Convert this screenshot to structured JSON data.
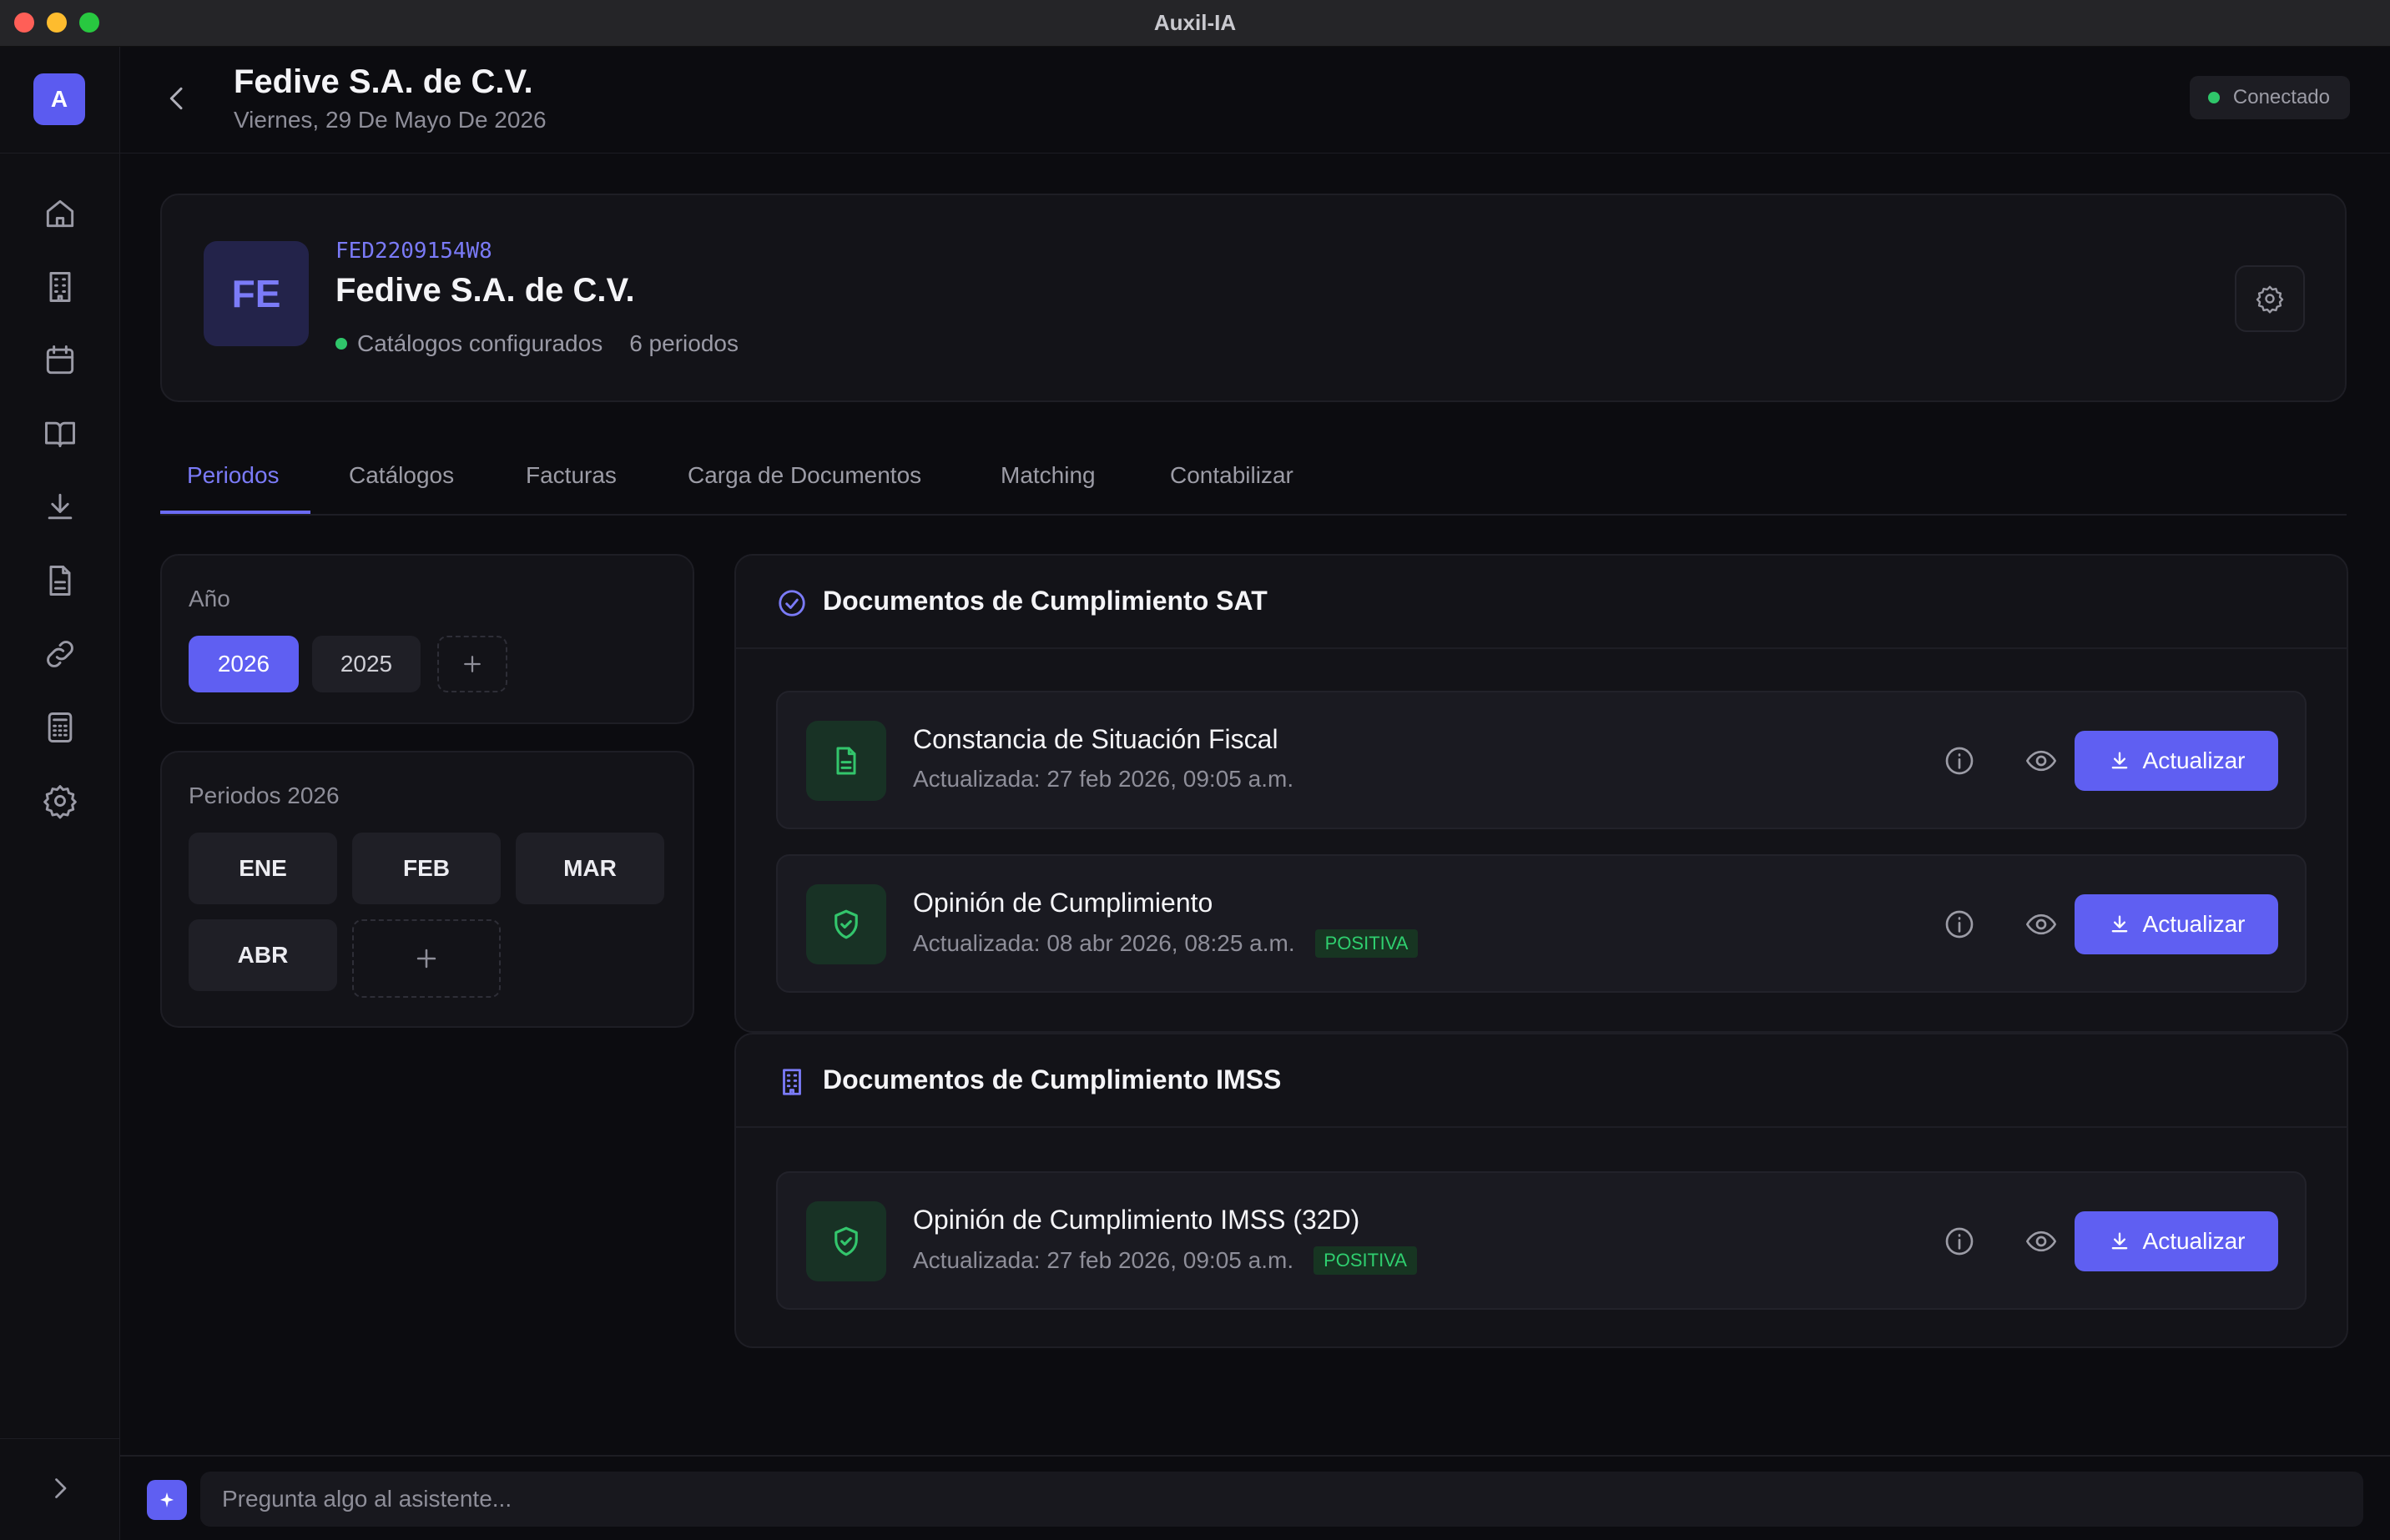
{
  "window": {
    "title": "Auxil-IA"
  },
  "user": {
    "avatar_letter": "A"
  },
  "header": {
    "title": "Fedive S.A. de C.V.",
    "date": "Viernes, 29 De Mayo De 2026",
    "status": "Conectado"
  },
  "company": {
    "initials": "FE",
    "rfc": "FED2209154W8",
    "name": "Fedive S.A. de C.V.",
    "catalog_status": "Catálogos configurados",
    "periods_count": "6 periodos"
  },
  "tabs": [
    "Periodos",
    "Catálogos",
    "Facturas",
    "Carga de Documentos",
    "Matching",
    "Contabilizar"
  ],
  "years": {
    "label": "Año",
    "items": [
      "2026",
      "2025"
    ],
    "selected": "2026"
  },
  "periods": {
    "label": "Periodos 2026",
    "months": [
      "ENE",
      "FEB",
      "MAR",
      "ABR"
    ]
  },
  "sections": [
    {
      "title": "Documentos de Cumplimiento SAT",
      "docs": [
        {
          "title": "Constancia de Situación Fiscal",
          "updated": "Actualizada: 27 feb 2026, 09:05 a.m.",
          "badge": "",
          "action": "Actualizar"
        },
        {
          "title": "Opinión de Cumplimiento",
          "updated": "Actualizada: 08 abr 2026, 08:25 a.m.",
          "badge": "POSITIVA",
          "action": "Actualizar"
        }
      ]
    },
    {
      "title": "Documentos de Cumplimiento IMSS",
      "docs": [
        {
          "title": "Opinión de Cumplimiento IMSS (32D)",
          "updated": "Actualizada: 27 feb 2026, 09:05 a.m.",
          "badge": "POSITIVA",
          "action": "Actualizar"
        }
      ]
    }
  ],
  "chat": {
    "placeholder": "Pregunta algo al asistente..."
  },
  "colors": {
    "accent": "#5f5ff2",
    "success": "#2fc66a",
    "background": "#0c0c10",
    "card": "#131318"
  }
}
